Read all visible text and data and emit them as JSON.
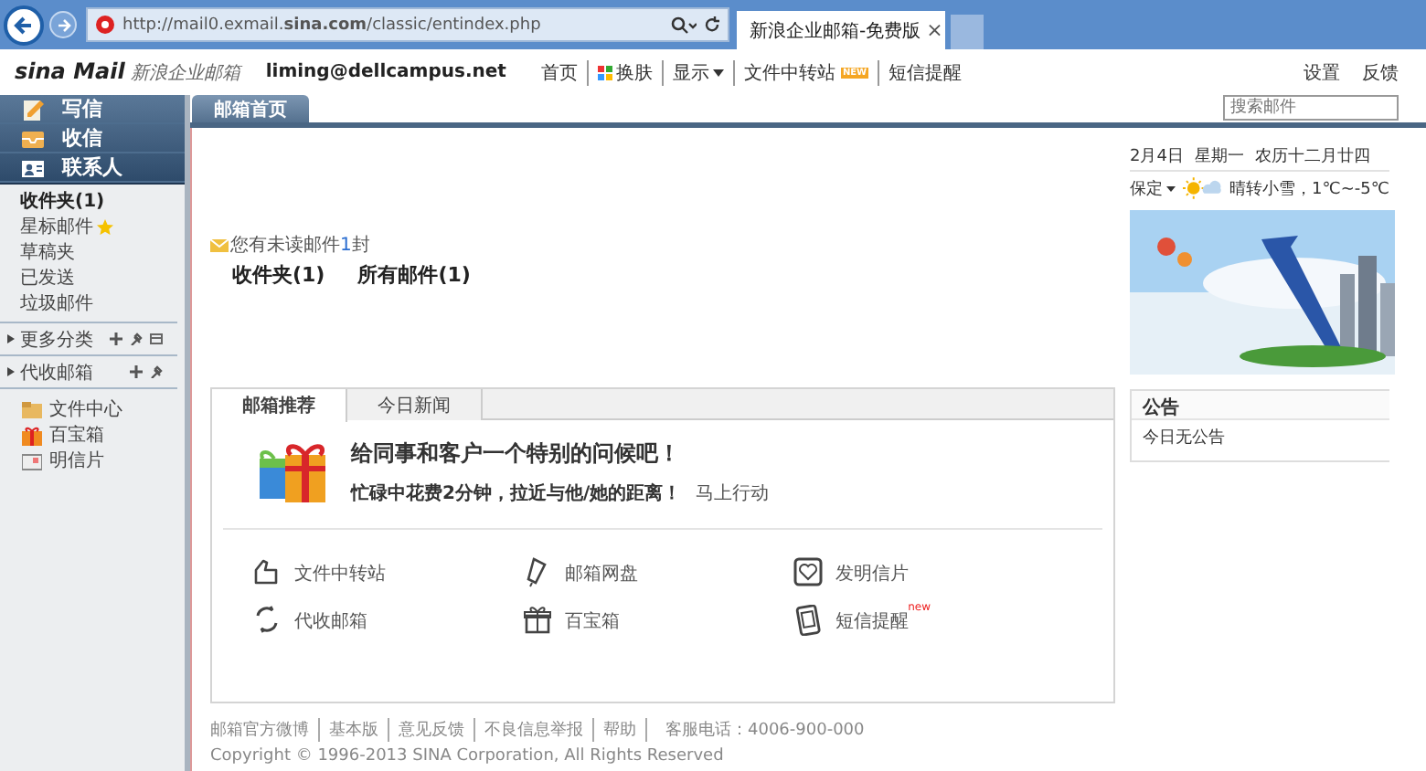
{
  "browser": {
    "address": "http://mail0.exmail.**sina.com**/classic/entindex.php",
    "tab_title": "新浪企业邮箱-免费版",
    "tab_close": "×"
  },
  "header": {
    "logo": "sina Mail",
    "logo_sub": "新浪企业邮箱",
    "account": "liming@dellcampus.net",
    "nav": [
      {
        "label": "首页",
        "kind": "link"
      },
      {
        "label": "换肤",
        "kind": "skin"
      },
      {
        "label": "显示",
        "kind": "menu"
      },
      {
        "label": "文件中转站",
        "kind": "link",
        "badge": "NEW"
      },
      {
        "label": "短信提醒",
        "kind": "link"
      }
    ],
    "right_links": [
      "设置",
      "反馈"
    ],
    "search": {
      "placeholder": "搜索邮件"
    }
  },
  "sidebar": {
    "actions": [
      {
        "label": "写信",
        "kind": "compose"
      },
      {
        "label": "收信",
        "kind": "inbox"
      },
      {
        "label": "联系人",
        "kind": "contacts"
      }
    ],
    "folders": [
      {
        "label": "收件夹(1)",
        "unread": true,
        "starred": false
      },
      {
        "label": "星标邮件",
        "unread": false,
        "starred": true
      },
      {
        "label": "草稿夹",
        "unread": false,
        "starred": false
      },
      {
        "label": "已发送",
        "unread": false,
        "starred": false
      },
      {
        "label": "垃圾邮件",
        "unread": false,
        "starred": false
      }
    ],
    "groups": [
      {
        "label": "更多分类",
        "kind": "categories",
        "expanded": false
      },
      {
        "label": "代收邮箱",
        "kind": "external",
        "expanded": false
      }
    ],
    "apps": [
      {
        "label": "文件中心",
        "kind": "files"
      },
      {
        "label": "百宝箱",
        "kind": "gift"
      },
      {
        "label": "明信片",
        "kind": "postcard"
      }
    ]
  },
  "main": {
    "tabs": [
      {
        "label": "邮箱首页",
        "selected": true
      }
    ],
    "unread": {
      "before": "您有未读邮件",
      "count": "1",
      "after": "封"
    },
    "summary": [
      "收件夹(1)",
      "所有邮件(1)"
    ],
    "promo": {
      "tabs": [
        {
          "label": "邮箱推荐",
          "selected": true
        },
        {
          "label": "今日新闻",
          "selected": false
        }
      ],
      "headline": "给同事和客户一个特别的问候吧！",
      "text": "忙碌中花费2分钟，拉近与他/她的距离！",
      "action": "马上行动",
      "features": [
        {
          "label": "文件中转站",
          "kind": "transfer"
        },
        {
          "label": "邮箱网盘",
          "kind": "disk"
        },
        {
          "label": "发明信片",
          "kind": "postcard"
        },
        {
          "label": "代收邮箱",
          "kind": "fetch"
        },
        {
          "label": "百宝箱",
          "kind": "gift"
        },
        {
          "label": "短信提醒",
          "kind": "phone",
          "badge": "new"
        }
      ]
    }
  },
  "footer": {
    "links": [
      "邮箱官方微博",
      "基本版",
      "意见反馈",
      "不良信息举报",
      "帮助"
    ],
    "phone": "客服电话：4006-900-000",
    "copyright": "Copyright  ©  1996-2013 SINA Corporation, All Rights Reserved"
  },
  "right": {
    "date": [
      "2月4日",
      "星期一",
      "农历十二月廿四"
    ],
    "city": "保定",
    "weather": "晴转小雪，1℃~-5℃",
    "notice_title": "公告",
    "notice": "今日无公告"
  }
}
